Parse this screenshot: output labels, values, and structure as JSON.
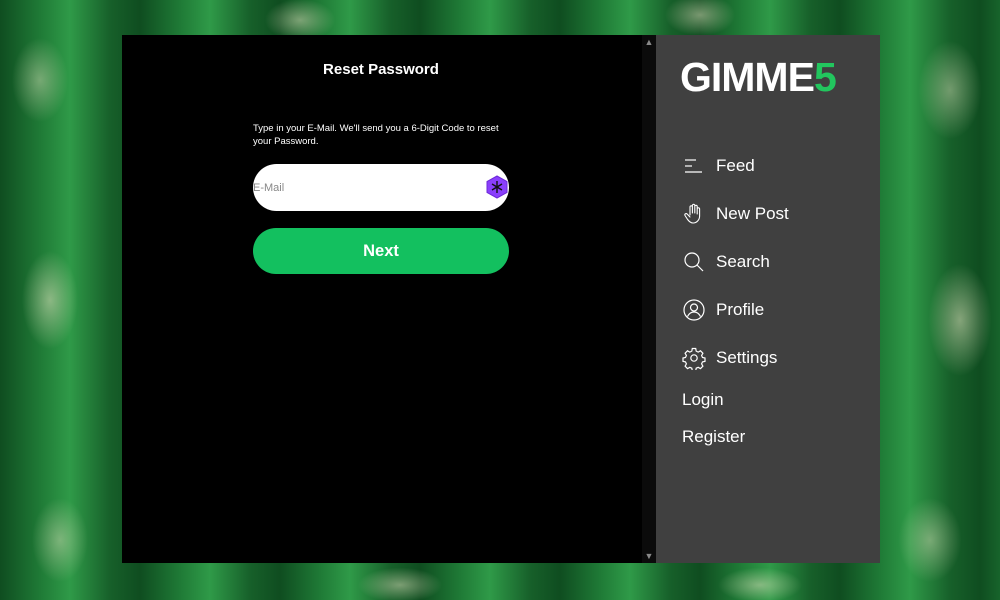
{
  "main": {
    "title": "Reset Password",
    "instructions": "Type in your E-Mail. We'll send you a 6-Digit Code to reset your Password.",
    "email": {
      "placeholder": "E-Mail",
      "value": ""
    },
    "next_label": "Next"
  },
  "sidebar": {
    "logo": {
      "main": "GIMME",
      "accent": "5"
    },
    "nav": [
      {
        "label": "Feed",
        "icon": "feed-icon"
      },
      {
        "label": "New Post",
        "icon": "hand-icon"
      },
      {
        "label": "Search",
        "icon": "search-icon"
      },
      {
        "label": "Profile",
        "icon": "profile-icon"
      },
      {
        "label": "Settings",
        "icon": "gear-icon"
      }
    ],
    "login_label": "Login",
    "register_label": "Register"
  },
  "colors": {
    "accent": "#13c05f",
    "sidebar_bg": "#404040",
    "main_bg": "#000000"
  }
}
